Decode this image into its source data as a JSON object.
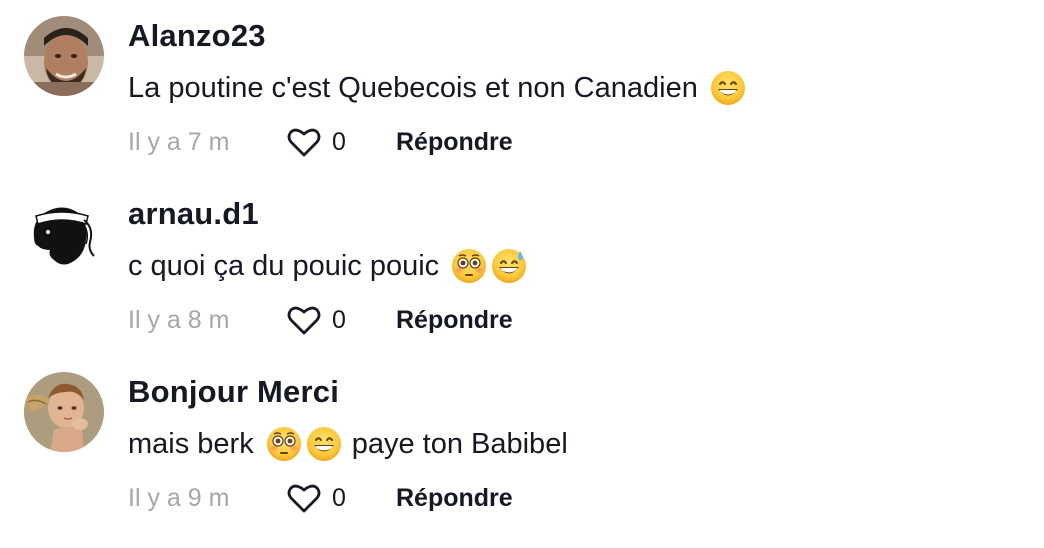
{
  "comments": [
    {
      "username": "Alanzo23",
      "text": "La poutine c'est Quebecois et non Canadien",
      "emojis": [
        "grinning-face-emoji"
      ],
      "time": "Il y a 7 m",
      "likes": "0",
      "reply_label": "Répondre"
    },
    {
      "username": "arnau.d1",
      "text": "c quoi ça du pouic pouic",
      "emojis": [
        "flushed-face-emoji",
        "sweat-smile-emoji"
      ],
      "time": "Il y a 8 m",
      "likes": "0",
      "reply_label": "Répondre"
    },
    {
      "username": "Bonjour Merci",
      "text": "mais berk",
      "text_after": "paye ton Babibel",
      "emojis": [
        "flushed-face-emoji",
        "grinning-face-emoji"
      ],
      "time": "Il y a 9 m",
      "likes": "0",
      "reply_label": "Répondre"
    }
  ],
  "colors": {
    "text_primary": "#161823",
    "text_secondary": "#a5a7ab",
    "background": "#ffffff"
  },
  "icons": {
    "like": "heart-outline-icon"
  }
}
